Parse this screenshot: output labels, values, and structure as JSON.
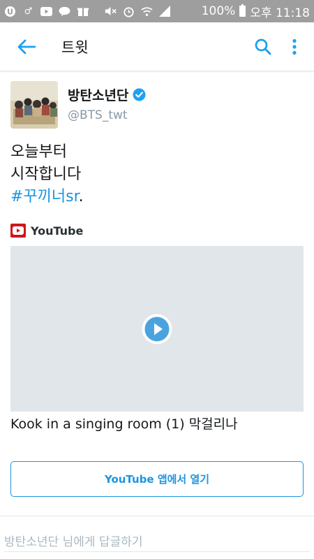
{
  "status_bar": {
    "battery": "100%",
    "time": "오후 11:18",
    "icons": [
      "u-plus-icon",
      "gender-icon",
      "youtube-icon",
      "talk-icon",
      "gift-icon",
      "mute-icon",
      "alarm-icon",
      "wifi-icon",
      "signal-icon",
      "battery-icon"
    ]
  },
  "app_bar": {
    "title": "트윗",
    "icons": [
      "back-arrow-icon",
      "search-icon",
      "more-vertical-icon"
    ],
    "accent": "#1da1f2"
  },
  "tweet": {
    "author": {
      "name": "방탄소년단",
      "handle": "@BTS_twt",
      "verified": true
    },
    "text_lines": [
      "오늘부터",
      "시작합니다"
    ],
    "hashtag": "#꾸끼너",
    "hashtag_suffix": "sr",
    "trailing": ".",
    "card": {
      "source": "YouTube",
      "title": "Kook in a singing room (1) 막걸리나",
      "open_button": "YouTube 앱에서 열기"
    }
  },
  "reply": {
    "placeholder": "방탄소년단 님에게 답글하기"
  },
  "colors": {
    "link": "#1b95e0",
    "status_bar": "#9e9e9e",
    "youtube_red": "#cc181e",
    "media_placeholder": "#e1e6ea"
  }
}
